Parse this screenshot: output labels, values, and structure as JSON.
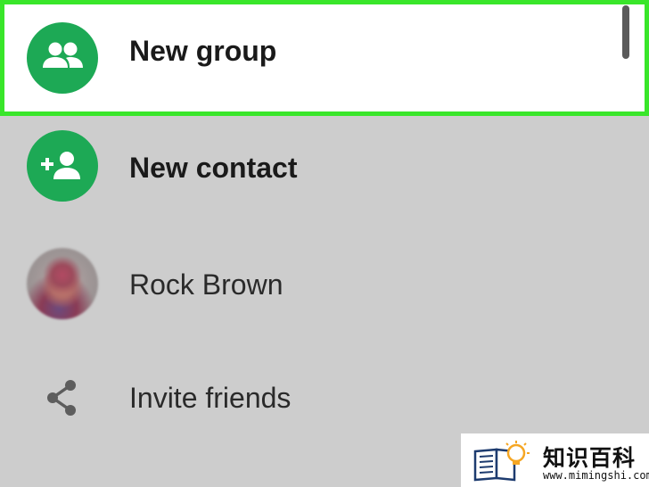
{
  "menu": {
    "items": [
      {
        "label": "New group",
        "icon": "group-icon",
        "highlighted": true
      },
      {
        "label": "New contact",
        "icon": "add-person-icon",
        "highlighted": false
      },
      {
        "label": "Rock Brown",
        "icon": "avatar-photo",
        "highlighted": false
      },
      {
        "label": "Invite friends",
        "icon": "share-icon",
        "highlighted": false
      }
    ]
  },
  "colors": {
    "icon_green": "#1da955",
    "highlight_border": "#39e62a",
    "background": "#cdcdcd",
    "highlight_background": "#ffffff"
  },
  "watermark": {
    "title": "知识百科",
    "url": "www.mimingshi.com"
  }
}
